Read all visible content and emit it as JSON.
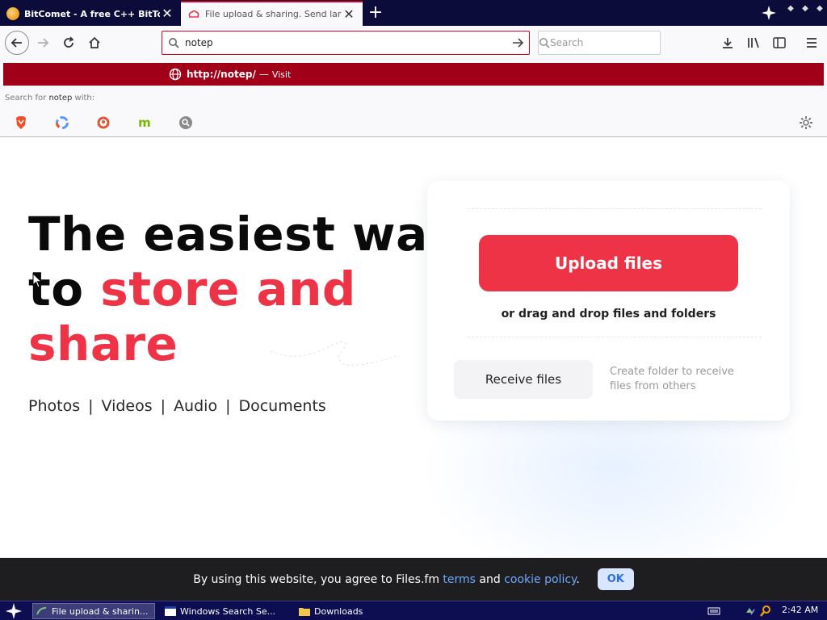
{
  "browser": {
    "tabs": [
      {
        "title": "BitComet - A free C++ BitTorrent",
        "active": false
      },
      {
        "title": "File upload & sharing. Send large f",
        "active": true
      }
    ],
    "new_tab_label": "+",
    "address": {
      "value": "notep"
    },
    "search": {
      "placeholder": "Search"
    }
  },
  "dropdown": {
    "visit_url_prefix": "http://",
    "visit_url_bold": "notep",
    "visit_url_suffix": "/",
    "visit_separator": "—",
    "visit_action": "Visit",
    "search_with_prefix": "Search for ",
    "search_with_term": "notep",
    "search_with_suffix": " with:",
    "engines": [
      "brave-icon",
      "qwant-icon",
      "duckduckgo-icon",
      "mojeek-icon",
      "search-engine-icon"
    ]
  },
  "page": {
    "hero_line1": "The easiest way",
    "hero_line2_plain": "to ",
    "hero_line2_accent": "store and",
    "hero_line3_accent": "share",
    "media_types": [
      "Photos",
      "Videos",
      "Audio",
      "Documents"
    ],
    "media_sep": "|",
    "upload_button": "Upload files",
    "drag_text": "or drag and drop files and folders",
    "receive_button": "Receive files",
    "receive_description": "Create folder to receive files from others",
    "accent_color": "#ee3346"
  },
  "cookie": {
    "text_before": "By using this website, you agree to Files.fm ",
    "link_terms": "terms",
    "text_and": " and ",
    "link_policy": "cookie policy",
    "text_end": ".",
    "ok_label": "OK"
  },
  "taskbar": {
    "tasks": [
      {
        "title": "File upload & sharin..."
      },
      {
        "title": "Windows Search Se..."
      },
      {
        "title": "Downloads"
      }
    ],
    "clock": "2:42 AM"
  }
}
